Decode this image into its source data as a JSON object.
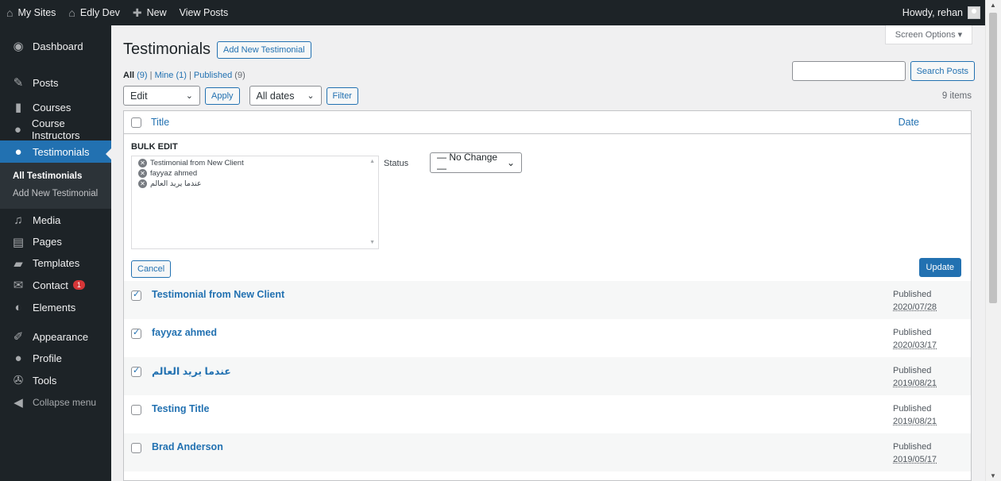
{
  "adminbar": {
    "my_sites": "My Sites",
    "site_name": "Edly Dev",
    "new": "New",
    "view_posts": "View Posts",
    "howdy": "Howdy, rehan"
  },
  "sidebar": {
    "items": [
      {
        "label": "Dashboard",
        "icon": "dashboard-icon"
      },
      {
        "label": "Posts",
        "icon": "pin-icon"
      },
      {
        "label": "Courses",
        "icon": "book-icon"
      },
      {
        "label": "Course Instructors",
        "icon": "user-icon"
      },
      {
        "label": "Testimonials",
        "icon": "user-icon"
      },
      {
        "label": "Media",
        "icon": "media-icon"
      },
      {
        "label": "Pages",
        "icon": "pages-icon"
      },
      {
        "label": "Templates",
        "icon": "folder-icon"
      },
      {
        "label": "Contact",
        "icon": "envelope-icon",
        "badge": "1"
      },
      {
        "label": "Elements",
        "icon": "elements-icon"
      },
      {
        "label": "Appearance",
        "icon": "brush-icon"
      },
      {
        "label": "Profile",
        "icon": "user-icon"
      },
      {
        "label": "Tools",
        "icon": "wrench-icon"
      },
      {
        "label": "Collapse menu",
        "icon": "collapse-icon"
      }
    ],
    "submenu": [
      "All Testimonials",
      "Add New Testimonial"
    ]
  },
  "main": {
    "screen_options": "Screen Options",
    "title": "Testimonials",
    "add_new": "Add New Testimonial",
    "filters": {
      "all": "All",
      "all_count": "(9)",
      "mine": "Mine",
      "mine_count": "(1)",
      "published": "Published",
      "published_count": "(9)"
    },
    "search_button": "Search Posts",
    "bulk_action": "Edit",
    "apply": "Apply",
    "dates": "All dates",
    "filter": "Filter",
    "items_count": "9 items",
    "columns": {
      "title": "Title",
      "date": "Date"
    },
    "bulk_edit": {
      "heading": "BULK EDIT",
      "items": [
        "Testimonial from New Client",
        "fayyaz ahmed",
        "عندما يريد العالم"
      ],
      "status_label": "Status",
      "status_value": "— No Change —",
      "cancel": "Cancel",
      "update": "Update"
    },
    "rows": [
      {
        "title": "Testimonial from New Client",
        "status": "Published",
        "date": "2020/07/28",
        "checked": true
      },
      {
        "title": "fayyaz ahmed",
        "status": "Published",
        "date": "2020/03/17",
        "checked": true
      },
      {
        "title": "عندما يريد العالم",
        "status": "Published",
        "date": "2019/08/21",
        "checked": true
      },
      {
        "title": "Testing Title",
        "status": "Published",
        "date": "2019/08/21",
        "checked": false
      },
      {
        "title": "Brad Anderson",
        "status": "Published",
        "date": "2019/05/17",
        "checked": false
      }
    ]
  }
}
